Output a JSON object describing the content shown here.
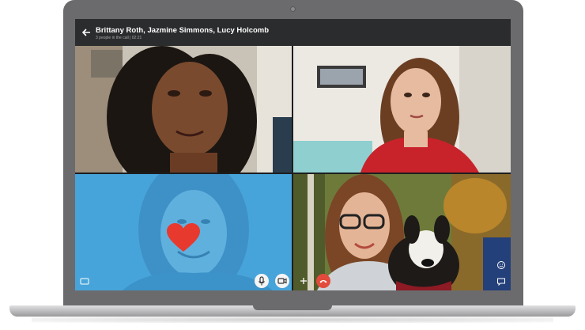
{
  "call": {
    "title": "Brittany Roth, Jazmine Simmons, Lucy Holcomb",
    "subtitle": "3 people in the call | 02:21"
  },
  "icons": {
    "back": "back-arrow-icon",
    "heart": "heart-icon",
    "mic": "microphone-icon",
    "video": "video-camera-icon",
    "add": "plus-icon",
    "end_call": "end-call-icon",
    "chat": "chat-icon",
    "emoji": "emoji-icon"
  },
  "colors": {
    "titlebar": "#2b2c2e",
    "end_call": "#e24a3b",
    "heart": "#e8392e",
    "tint_overlay": "#3aa0e0"
  }
}
